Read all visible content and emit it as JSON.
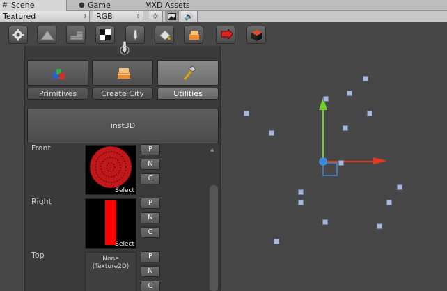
{
  "tabs": {
    "scene": "Scene",
    "game": "Game",
    "mxd": "MXD Assets"
  },
  "toolbar": {
    "render_mode": "Textured",
    "color_mode": "RGB"
  },
  "panel": {
    "categories": [
      "Primitives",
      "Create City",
      "Utilities"
    ],
    "selected_category": "Utilities",
    "inst_button": "inst3D",
    "rows": [
      {
        "label": "Front",
        "select": "Select",
        "buttons": [
          "P",
          "N",
          "C"
        ]
      },
      {
        "label": "Right",
        "select": "Select",
        "buttons": [
          "P",
          "N",
          "C"
        ]
      },
      {
        "label": "Top",
        "texture": "None\n(Texture2D)",
        "buttons": [
          "P",
          "N",
          "C"
        ]
      }
    ]
  },
  "colors": {
    "gizmo_x": "#e03a1e",
    "gizmo_y": "#74d12f",
    "gizmo_center": "#3f8bd8",
    "front_pattern": "#c0181a",
    "right_bar": "#ff0000"
  }
}
